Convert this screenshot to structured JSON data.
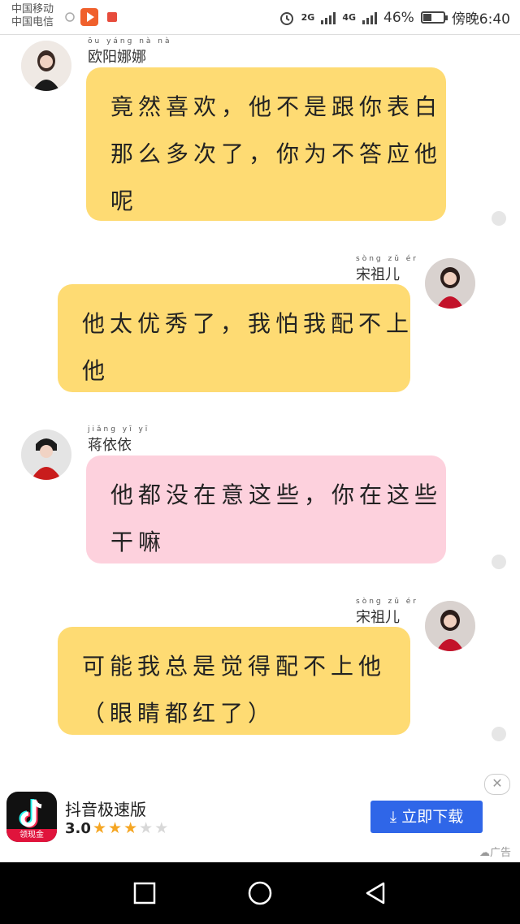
{
  "status_bar": {
    "carrier_1": "中国移动",
    "carrier_2": "中国电信",
    "network_1": "2G",
    "network_2": "4G",
    "battery": "46%",
    "battery_level": 0.46,
    "time": "傍晚6:40"
  },
  "messages": [
    {
      "side": "left",
      "name": "欧阳娜娜",
      "name_pinyin": "ōu yáng nà nà",
      "color": "#fedb73",
      "lines": [
        "竟然喜欢，他不是跟你表白",
        "那么多次了，你为不答应他",
        "呢"
      ]
    },
    {
      "side": "right",
      "name": "宋祖儿",
      "name_pinyin": "sòng zǔ ér",
      "color": "#fedb73",
      "lines": [
        "他太优秀了，我怕我配不上",
        "他"
      ]
    },
    {
      "side": "left",
      "name": "蒋依依",
      "name_pinyin": "jiǎng yī yī",
      "color": "#fdd1dd",
      "lines": [
        "他都没在意这些，你在这些",
        "干嘛"
      ]
    },
    {
      "side": "right",
      "name": "宋祖儿",
      "name_pinyin": "sòng zǔ ér",
      "color": "#fedb73",
      "lines": [
        "可能我总是觉得配不上他",
        "（眼睛都红了）"
      ]
    }
  ],
  "ad": {
    "app_name": "抖音极速版",
    "badge": "领现金",
    "rating": "3.0",
    "rating_value": 3,
    "download_label": "立即下载",
    "tag": "广告",
    "close_icon": "close-icon"
  },
  "nav": {
    "icons": [
      "recent-apps-icon",
      "home-icon",
      "back-icon"
    ]
  }
}
